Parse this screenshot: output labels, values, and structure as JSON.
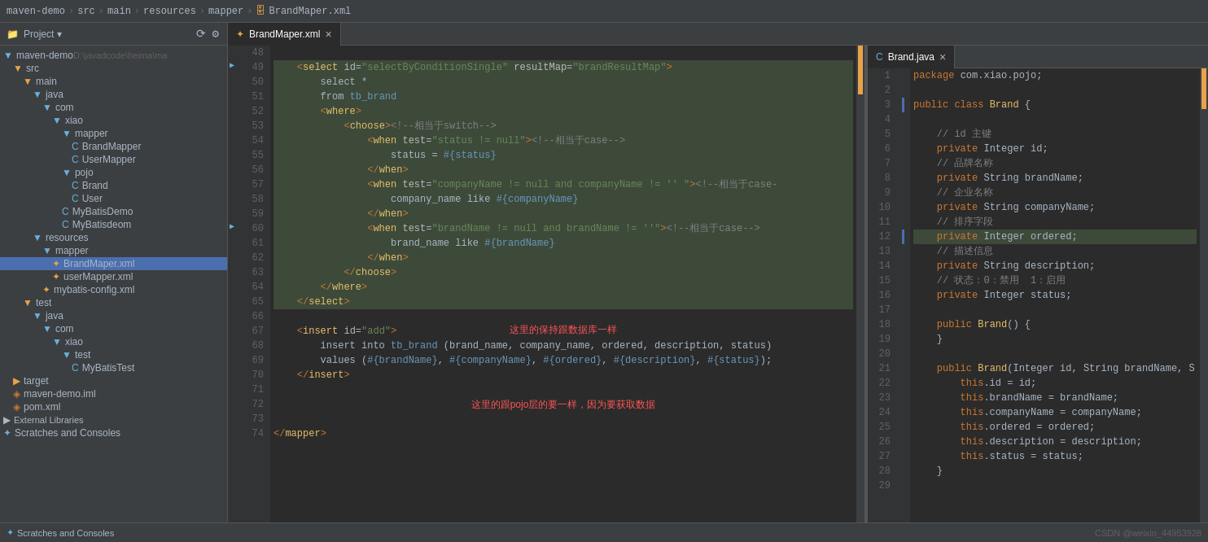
{
  "topbar": {
    "breadcrumb": [
      "maven-demo",
      "src",
      "main",
      "resources",
      "mapper",
      "BrandMaper.xml"
    ]
  },
  "sidebar": {
    "title": "Project",
    "items": [
      {
        "id": "maven-demo",
        "label": "maven-demo",
        "indent": 0,
        "type": "root",
        "path": "D:\\javadcode\\heima\\ma"
      },
      {
        "id": "src",
        "label": "src",
        "indent": 1,
        "type": "folder"
      },
      {
        "id": "main",
        "label": "main",
        "indent": 2,
        "type": "folder"
      },
      {
        "id": "java",
        "label": "java",
        "indent": 3,
        "type": "folder-blue"
      },
      {
        "id": "com",
        "label": "com",
        "indent": 4,
        "type": "folder-blue"
      },
      {
        "id": "xiao1",
        "label": "xiao",
        "indent": 5,
        "type": "folder-blue"
      },
      {
        "id": "mapper1",
        "label": "mapper",
        "indent": 6,
        "type": "folder-blue"
      },
      {
        "id": "BrandMapper",
        "label": "BrandMapper",
        "indent": 7,
        "type": "java"
      },
      {
        "id": "UserMapper",
        "label": "UserMapper",
        "indent": 7,
        "type": "java"
      },
      {
        "id": "pojo",
        "label": "pojo",
        "indent": 6,
        "type": "folder-blue"
      },
      {
        "id": "Brand",
        "label": "Brand",
        "indent": 7,
        "type": "java-class"
      },
      {
        "id": "User",
        "label": "User",
        "indent": 7,
        "type": "java-class"
      },
      {
        "id": "MyBatisDemo",
        "label": "MyBatisDemo",
        "indent": 6,
        "type": "java-class"
      },
      {
        "id": "MyBatisdeom",
        "label": "MyBatisdeom",
        "indent": 6,
        "type": "java-class"
      },
      {
        "id": "resources",
        "label": "resources",
        "indent": 3,
        "type": "folder-blue"
      },
      {
        "id": "mapper2",
        "label": "mapper",
        "indent": 4,
        "type": "folder-blue"
      },
      {
        "id": "BrandMaper-xml",
        "label": "BrandMaper.xml",
        "indent": 5,
        "type": "xml",
        "selected": true
      },
      {
        "id": "userMapper-xml",
        "label": "userMapper.xml",
        "indent": 5,
        "type": "xml"
      },
      {
        "id": "mybatis-config",
        "label": "mybatis-config.xml",
        "indent": 4,
        "type": "xml"
      },
      {
        "id": "test",
        "label": "test",
        "indent": 2,
        "type": "folder"
      },
      {
        "id": "java2",
        "label": "java",
        "indent": 3,
        "type": "folder-blue"
      },
      {
        "id": "com2",
        "label": "com",
        "indent": 4,
        "type": "folder-blue"
      },
      {
        "id": "xiao2",
        "label": "xiao",
        "indent": 5,
        "type": "folder-blue"
      },
      {
        "id": "test2",
        "label": "test",
        "indent": 6,
        "type": "folder-blue"
      },
      {
        "id": "MyBatisTest",
        "label": "MyBatisTest",
        "indent": 7,
        "type": "java-class"
      },
      {
        "id": "target",
        "label": "target",
        "indent": 1,
        "type": "folder"
      },
      {
        "id": "maven-demo-iml",
        "label": "maven-demo.iml",
        "indent": 1,
        "type": "iml"
      },
      {
        "id": "pom-xml",
        "label": "pom.xml",
        "indent": 1,
        "type": "pom"
      },
      {
        "id": "ext-libs",
        "label": "External Libraries",
        "indent": 0,
        "type": "ext"
      },
      {
        "id": "scratches",
        "label": "Scratches and Consoles",
        "indent": 0,
        "type": "scratches"
      }
    ]
  },
  "left_editor": {
    "tab_label": "BrandMaper.xml",
    "lines": [
      {
        "num": 48,
        "content": ""
      },
      {
        "num": 49,
        "content": "    <select id=\"selectByConditionSingle\" resultMap=\"brandResultMap\">"
      },
      {
        "num": 50,
        "content": "        select *"
      },
      {
        "num": 51,
        "content": "        from tb_brand"
      },
      {
        "num": 52,
        "content": "        <where>"
      },
      {
        "num": 53,
        "content": "            <choose><!--相当于switch-->"
      },
      {
        "num": 54,
        "content": "                <when test=\"status != null\"><!--相当于case-->"
      },
      {
        "num": 55,
        "content": "                    status = #{status}"
      },
      {
        "num": 56,
        "content": "                </when>"
      },
      {
        "num": 57,
        "content": "                <when test=\"companyName != null and companyName != '' \"><!--相当于case-"
      },
      {
        "num": 58,
        "content": "                    company_name like #{companyName}"
      },
      {
        "num": 59,
        "content": "                </when>"
      },
      {
        "num": 60,
        "content": "                <when test=\"brandName != null and brandName != ''\"><!--相当于case-->"
      },
      {
        "num": 61,
        "content": "                    brand_name like #{brandName}"
      },
      {
        "num": 62,
        "content": "                </when>"
      },
      {
        "num": 63,
        "content": "            </choose>"
      },
      {
        "num": 64,
        "content": "        </where>"
      },
      {
        "num": 65,
        "content": "    </select>"
      },
      {
        "num": 66,
        "content": ""
      },
      {
        "num": 67,
        "content": "    <insert id=\"add\">"
      },
      {
        "num": 68,
        "content": "        insert into tb_brand (brand_name, company_name, ordered, description, status)"
      },
      {
        "num": 69,
        "content": "        values (#{brandName}, #{companyName}, #{ordered}, #{description}, #{status});"
      },
      {
        "num": 70,
        "content": "    </insert>"
      },
      {
        "num": 71,
        "content": ""
      },
      {
        "num": 72,
        "content": ""
      },
      {
        "num": 73,
        "content": "</mapper>"
      },
      {
        "num": 74,
        "content": ""
      }
    ],
    "annotation1": "这里的保持跟数据库一样",
    "annotation2": "这里的跟pojo层的要一样，因为要获取数据"
  },
  "right_editor": {
    "tab_label": "Brand.java",
    "lines": [
      {
        "num": 1,
        "content": "package com.xiao.pojo;"
      },
      {
        "num": 2,
        "content": ""
      },
      {
        "num": 3,
        "content": "public class Brand {"
      },
      {
        "num": 4,
        "content": ""
      },
      {
        "num": 5,
        "content": "    // id 主键"
      },
      {
        "num": 6,
        "content": "    private Integer id;"
      },
      {
        "num": 7,
        "content": "    // 品牌名称"
      },
      {
        "num": 8,
        "content": "    private String brandName;"
      },
      {
        "num": 9,
        "content": "    // 企业名称"
      },
      {
        "num": 10,
        "content": "    private String companyName;"
      },
      {
        "num": 11,
        "content": "    // 排序字段"
      },
      {
        "num": 12,
        "content": "    private Integer ordered;"
      },
      {
        "num": 13,
        "content": "    // 描述信息"
      },
      {
        "num": 14,
        "content": "    private String description;"
      },
      {
        "num": 15,
        "content": "    // 状态：0：禁用  1：启用"
      },
      {
        "num": 16,
        "content": "    private Integer status;"
      },
      {
        "num": 17,
        "content": ""
      },
      {
        "num": 18,
        "content": "    public Brand() {"
      },
      {
        "num": 19,
        "content": "    }"
      },
      {
        "num": 20,
        "content": ""
      },
      {
        "num": 21,
        "content": "    public Brand(Integer id, String brandName, S"
      },
      {
        "num": 22,
        "content": "        this.id = id;"
      },
      {
        "num": 23,
        "content": "        this.brandName = brandName;"
      },
      {
        "num": 24,
        "content": "        this.companyName = companyName;"
      },
      {
        "num": 25,
        "content": "        this.ordered = ordered;"
      },
      {
        "num": 26,
        "content": "        this.description = description;"
      },
      {
        "num": 27,
        "content": "        this.status = status;"
      },
      {
        "num": 28,
        "content": "    }"
      },
      {
        "num": 29,
        "content": ""
      }
    ]
  },
  "status_bar": {
    "scratches_label": "Scratches and Consoles",
    "watermark": "CSDN @weixin_44953928"
  }
}
